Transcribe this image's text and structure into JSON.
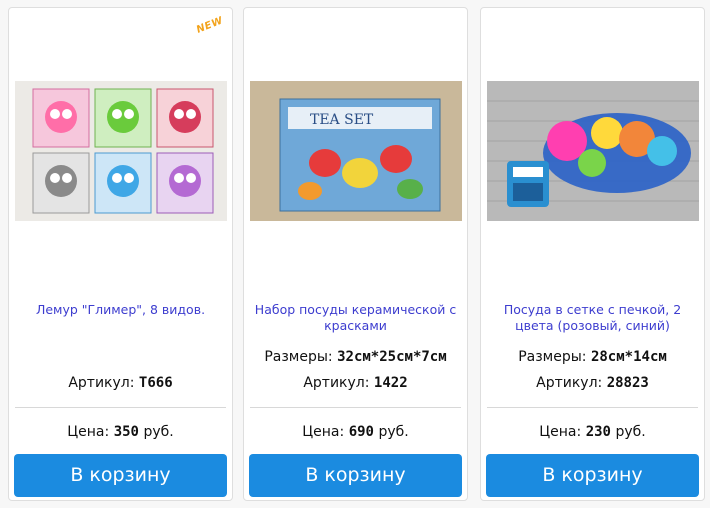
{
  "products": [
    {
      "badge": "NEW",
      "title": "Лемур \"Глимер\", 8 видов.",
      "sizes_label": "",
      "sizes_value": "",
      "article_label": "Артикул:",
      "article_value": "T666",
      "price_label": "Цена:",
      "price_value": "350",
      "price_currency": "руб.",
      "button_label": "В корзину",
      "image": "lemur-toys-boxes"
    },
    {
      "badge": "",
      "title": "Набор посуды керамической с красками",
      "sizes_label": "Размеры:",
      "sizes_value": "32см*25см*7см",
      "article_label": "Артикул:",
      "article_value": "1422",
      "price_label": "Цена:",
      "price_value": "690",
      "price_currency": "руб.",
      "button_label": "В корзину",
      "image": "tea-set-box",
      "image_text": "TEA SET"
    },
    {
      "badge": "",
      "title": "Посуда в сетке с печкой, 2 цвета (розовый, синий)",
      "sizes_label": "Размеры:",
      "sizes_value": "28см*14см",
      "article_label": "Артикул:",
      "article_value": "28823",
      "price_label": "Цена:",
      "price_value": "230",
      "price_currency": "руб.",
      "button_label": "В корзину",
      "image": "toy-dishes-net"
    }
  ],
  "colors": {
    "title": "#3d3dcf",
    "button": "#1b8be0",
    "badge": "#f2a31c"
  }
}
